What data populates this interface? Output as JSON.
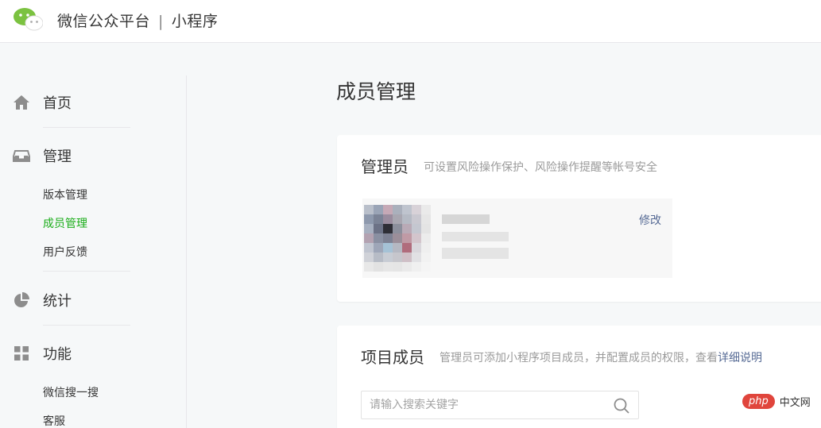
{
  "header": {
    "title": "微信公众平台",
    "separator": "|",
    "subtitle": "小程序"
  },
  "sidebar": {
    "sections": [
      {
        "label": "首页",
        "icon": "home-icon"
      },
      {
        "label": "管理",
        "icon": "inbox-icon"
      },
      {
        "label": "统计",
        "icon": "pie-chart-icon"
      },
      {
        "label": "功能",
        "icon": "grid-icon"
      }
    ],
    "manage_items": [
      "版本管理",
      "成员管理",
      "用户反馈"
    ],
    "feature_items": [
      "微信搜一搜",
      "客服"
    ],
    "active_item": "成员管理"
  },
  "main": {
    "page_title": "成员管理",
    "admin_card": {
      "title": "管理员",
      "desc": "可设置风险操作保护、风险操作提醒等帐号安全",
      "edit_label": "修改"
    },
    "members_card": {
      "title": "项目成员",
      "desc": "管理员可添加小程序项目成员，并配置成员的权限，查看",
      "desc_link": "详细说明",
      "search_placeholder": "请输入搜索关键字"
    }
  },
  "watermark": {
    "pill": "php",
    "text": "中文网"
  },
  "colors": {
    "accent_green": "#1aad19",
    "link_blue": "#576b95",
    "watermark_red": "#e0453c"
  }
}
